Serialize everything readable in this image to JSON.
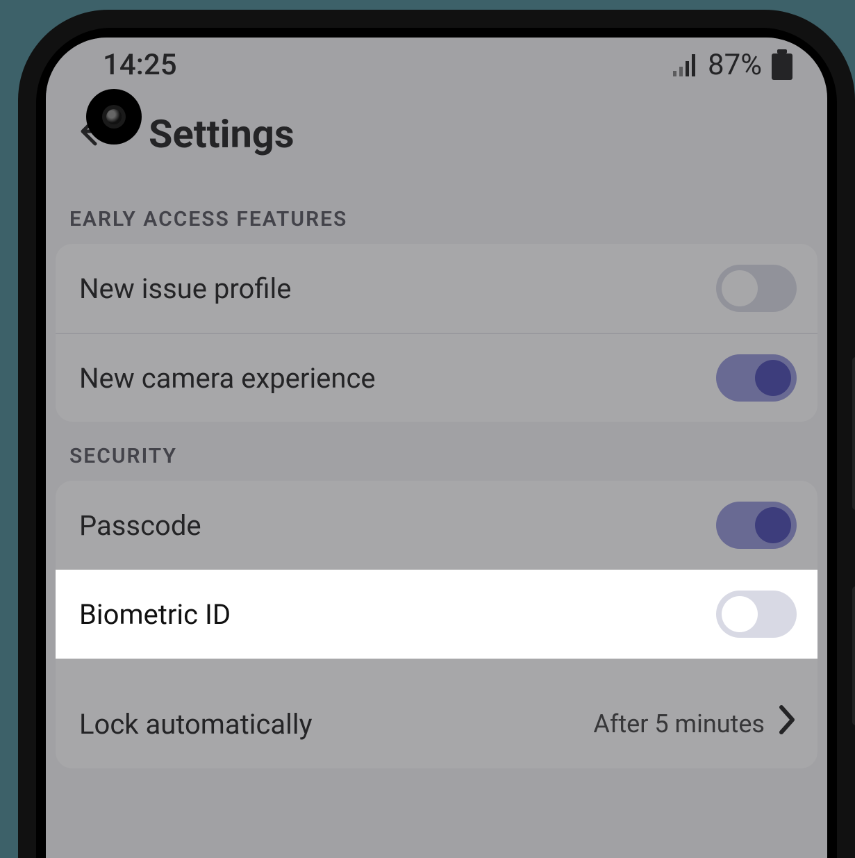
{
  "statusbar": {
    "time": "14:25",
    "battery_percent": "87%"
  },
  "header": {
    "title": "Settings"
  },
  "sections": {
    "early_access": {
      "label": "EARLY ACCESS FEATURES",
      "new_issue_profile": {
        "label": "New issue profile",
        "on": false
      },
      "new_camera_experience": {
        "label": "New camera experience",
        "on": true
      }
    },
    "security": {
      "label": "SECURITY",
      "passcode": {
        "label": "Passcode",
        "on": true
      },
      "biometric_id": {
        "label": "Biometric ID",
        "on": false
      },
      "lock_automatically": {
        "label": "Lock automatically",
        "value": "After 5 minutes"
      }
    }
  }
}
